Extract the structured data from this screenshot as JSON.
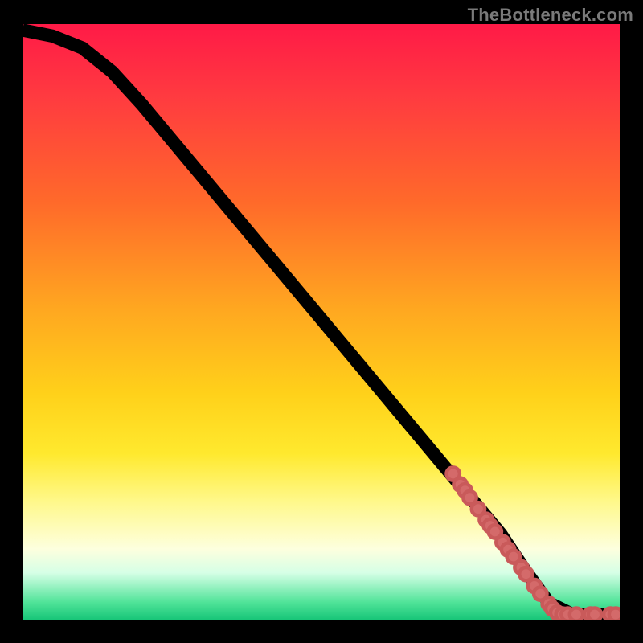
{
  "watermark": "TheBottleneck.com",
  "colors": {
    "gradient_top": "#ff1a47",
    "gradient_mid": "#ffd11a",
    "gradient_bottom": "#15c477",
    "curve": "#000000",
    "dots": "#d46a6a",
    "background": "#000000"
  },
  "chart_data": {
    "type": "line",
    "title": "",
    "xlabel": "",
    "ylabel": "",
    "xlim": [
      0,
      100
    ],
    "ylim": [
      0,
      100
    ],
    "grid": false,
    "legend": false,
    "series": [
      {
        "name": "curve",
        "x": [
          0,
          5,
          10,
          15,
          20,
          25,
          30,
          35,
          40,
          45,
          50,
          55,
          60,
          65,
          70,
          75,
          80,
          84,
          88,
          92,
          96,
          100
        ],
        "y": [
          99,
          98,
          96,
          92,
          86.5,
          80.5,
          74.5,
          68.5,
          62.5,
          56.5,
          50.5,
          44.5,
          38.5,
          32.5,
          26.5,
          20.5,
          14.5,
          8.5,
          3,
          1,
          1,
          1
        ]
      }
    ],
    "scatter_points": {
      "name": "highlight-dots",
      "points": [
        {
          "x": 72,
          "y": 24.6
        },
        {
          "x": 73.2,
          "y": 22.8
        },
        {
          "x": 74,
          "y": 21.8
        },
        {
          "x": 74.8,
          "y": 20.6
        },
        {
          "x": 76.2,
          "y": 18.7
        },
        {
          "x": 77.5,
          "y": 16.9
        },
        {
          "x": 78.2,
          "y": 15.9
        },
        {
          "x": 79,
          "y": 14.9
        },
        {
          "x": 80.3,
          "y": 13.1
        },
        {
          "x": 81.2,
          "y": 11.9
        },
        {
          "x": 82.1,
          "y": 10.7
        },
        {
          "x": 83.4,
          "y": 8.9
        },
        {
          "x": 84.2,
          "y": 7.8
        },
        {
          "x": 85.6,
          "y": 5.8
        },
        {
          "x": 86.6,
          "y": 4.5
        },
        {
          "x": 88,
          "y": 2.8
        },
        {
          "x": 88.6,
          "y": 2.0
        },
        {
          "x": 89.4,
          "y": 1.3
        },
        {
          "x": 90.3,
          "y": 1.0
        },
        {
          "x": 91.2,
          "y": 1.0
        },
        {
          "x": 92.6,
          "y": 1.0
        },
        {
          "x": 95.0,
          "y": 1.0
        },
        {
          "x": 95.7,
          "y": 1.0
        },
        {
          "x": 98.3,
          "y": 1.0
        },
        {
          "x": 99.2,
          "y": 1.0
        }
      ]
    }
  }
}
